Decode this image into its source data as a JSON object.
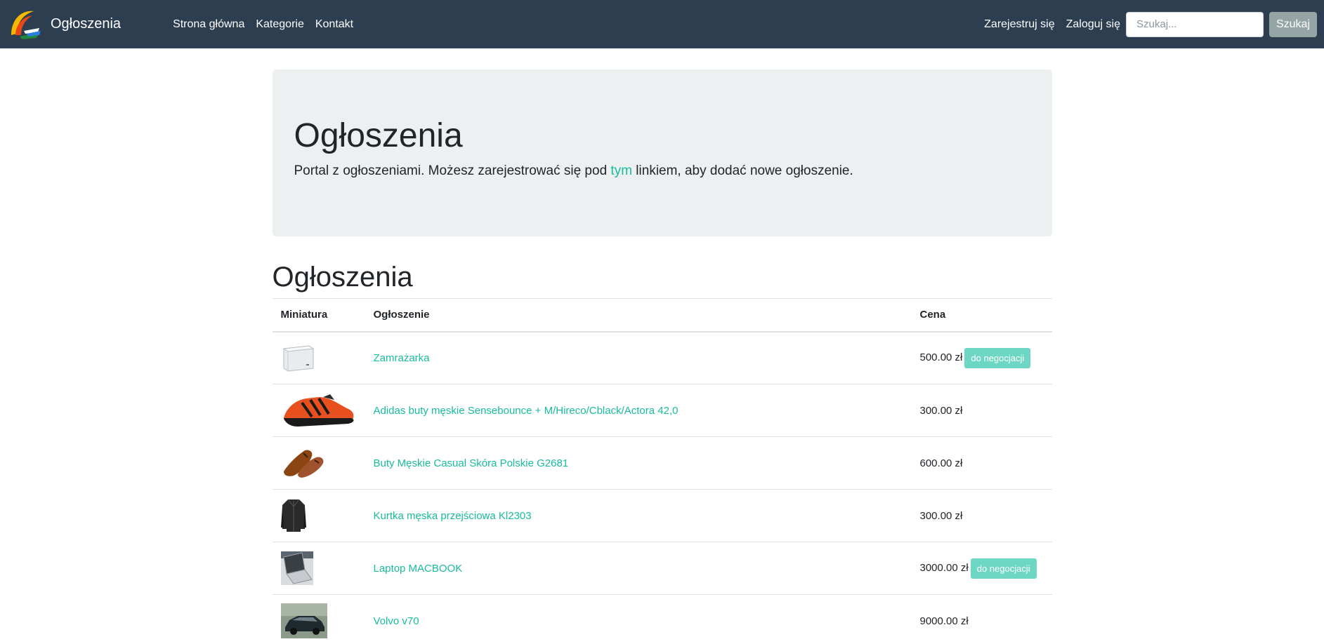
{
  "navbar": {
    "brand": "Ogłoszenia",
    "links": [
      "Strona główna",
      "Kategorie",
      "Kontakt"
    ],
    "register": "Zarejestruj się",
    "login": "Zaloguj się",
    "search_placeholder": "Szukaj...",
    "search_button": "Szukaj"
  },
  "jumbotron": {
    "title": "Ogłoszenia",
    "lead_before": "Portal z ogłoszeniami. Możesz zarejestrować się pod ",
    "lead_link": "tym",
    "lead_after": " linkiem, aby dodać nowe ogłoszenie."
  },
  "listing": {
    "title": "Ogłoszenia",
    "columns": [
      "Miniatura",
      "Ogłoszenie",
      "Cena"
    ],
    "rows": [
      {
        "thumb": "freezer-image",
        "title": "Zamrażarka",
        "price": "500.00 zł",
        "badge": "do negocjacji"
      },
      {
        "thumb": "shoe-image",
        "title": "Adidas buty męskie Sensebounce + M/Hireco/Cblack/Actora 42,0",
        "price": "300.00 zł",
        "badge": ""
      },
      {
        "thumb": "brown-shoes-image",
        "title": "Buty Męskie Casual Skóra Polskie G2681",
        "price": "600.00 zł",
        "badge": ""
      },
      {
        "thumb": "jacket-image",
        "title": "Kurtka męska przejściowa Kl2303",
        "price": "300.00 zł",
        "badge": ""
      },
      {
        "thumb": "laptop-image",
        "title": "Laptop MACBOOK",
        "price": "3000.00 zł",
        "badge": "do negocjacji"
      },
      {
        "thumb": "car-image",
        "title": "Volvo v70",
        "price": "9000.00 zł",
        "badge": ""
      }
    ]
  },
  "colors": {
    "navbar_bg": "#2c3e50",
    "accent": "#18bc9c",
    "badge_bg": "#6dd7c4",
    "jumbotron_bg": "#ecf0f1",
    "search_button_bg": "#95a5a6"
  }
}
